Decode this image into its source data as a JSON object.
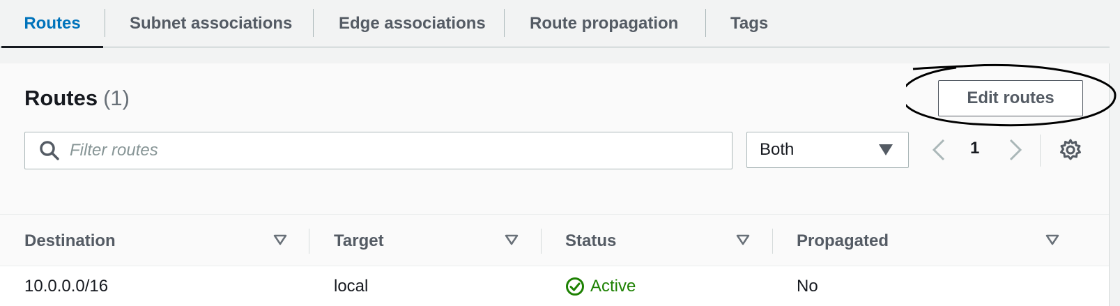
{
  "tabs": [
    {
      "label": "Routes",
      "active": true
    },
    {
      "label": "Subnet associations",
      "active": false
    },
    {
      "label": "Edge associations",
      "active": false
    },
    {
      "label": "Route propagation",
      "active": false
    },
    {
      "label": "Tags",
      "active": false
    }
  ],
  "panel": {
    "title": "Routes",
    "count": "(1)",
    "edit_button": "Edit routes",
    "search": {
      "placeholder": "Filter routes",
      "value": ""
    },
    "filter_select": {
      "value": "Both"
    },
    "pagination": {
      "current_page": "1"
    }
  },
  "table": {
    "columns": [
      "Destination",
      "Target",
      "Status",
      "Propagated"
    ],
    "rows": [
      {
        "destination": "10.0.0.0/16",
        "target": "local",
        "status": "Active",
        "propagated": "No"
      }
    ]
  },
  "colors": {
    "active_tab": "#0073bb",
    "status_active": "#1d8102",
    "text_secondary": "#545b64"
  },
  "icons": [
    "search-icon",
    "caret-down-icon",
    "chevron-left-icon",
    "chevron-right-icon",
    "settings-gear-icon",
    "sort-icon",
    "status-check-icon"
  ]
}
